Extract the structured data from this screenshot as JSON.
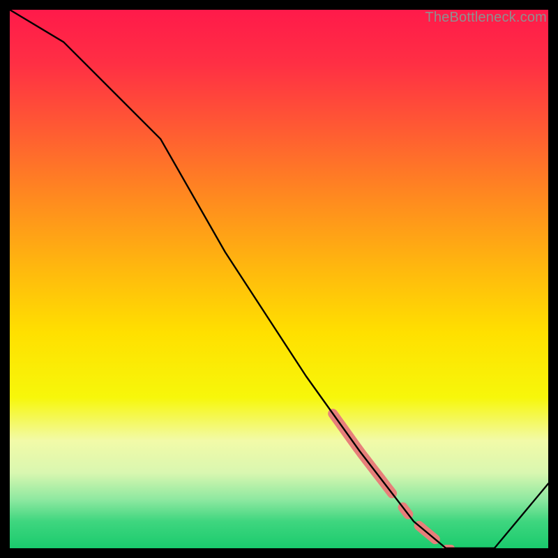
{
  "watermark": "TheBottleneck.com",
  "gradient_stops": [
    {
      "offset": 0.0,
      "color": "#ff1a4a"
    },
    {
      "offset": 0.1,
      "color": "#ff2f44"
    },
    {
      "offset": 0.22,
      "color": "#ff5a33"
    },
    {
      "offset": 0.35,
      "color": "#ff8a1f"
    },
    {
      "offset": 0.48,
      "color": "#ffb80e"
    },
    {
      "offset": 0.6,
      "color": "#ffe000"
    },
    {
      "offset": 0.72,
      "color": "#f7f70a"
    },
    {
      "offset": 0.8,
      "color": "#f2faa8"
    },
    {
      "offset": 0.86,
      "color": "#d9f7b0"
    },
    {
      "offset": 0.91,
      "color": "#8de8a0"
    },
    {
      "offset": 0.95,
      "color": "#3fd67f"
    },
    {
      "offset": 1.0,
      "color": "#1acb6d"
    }
  ],
  "chart_data": {
    "type": "line",
    "title": "",
    "xlabel": "",
    "ylabel": "",
    "xlim": [
      0,
      100
    ],
    "ylim": [
      0,
      100
    ],
    "x": [
      0,
      10,
      20,
      28,
      40,
      55,
      65,
      75,
      81,
      90,
      100
    ],
    "values": [
      100,
      94,
      84,
      76,
      55,
      32,
      18,
      5,
      0,
      0,
      12
    ],
    "highlight_segments": [
      {
        "from_x": 60,
        "to_x": 71,
        "thick": true
      },
      {
        "from_x": 73,
        "to_x": 74,
        "thick": true
      },
      {
        "from_x": 76,
        "to_x": 79,
        "thick": true
      },
      {
        "from_x": 81,
        "to_x": 82,
        "thick": false
      }
    ],
    "highlight_color": "#e77f7a"
  }
}
